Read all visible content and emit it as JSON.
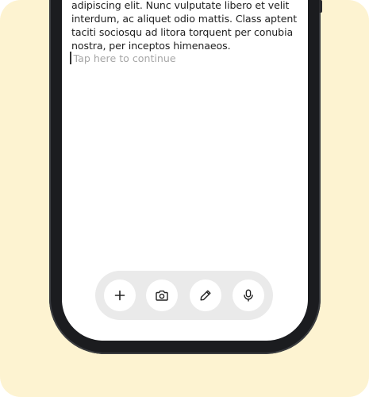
{
  "note": {
    "lines": [
      "adipiscing elit. Nunc vulputate libero et velit",
      "interdum, ac aliquet odio mattis. Class aptent",
      "taciti sociosqu ad litora torquent per conubia",
      "nostra, per inceptos himenaeos."
    ]
  },
  "editor": {
    "placeholder": "Tap here to continue"
  },
  "toolbar": {
    "buttons": [
      {
        "icon": "plus-icon"
      },
      {
        "icon": "camera-icon"
      },
      {
        "icon": "pencil-icon"
      },
      {
        "icon": "microphone-icon"
      }
    ]
  },
  "colors": {
    "backdrop": "#fdf3d1",
    "device_frame": "#1b1c1f",
    "screen": "#ffffff",
    "toolbar": "#eaeaea",
    "text": "#1f1f1f",
    "placeholder": "#a7a7a7"
  }
}
